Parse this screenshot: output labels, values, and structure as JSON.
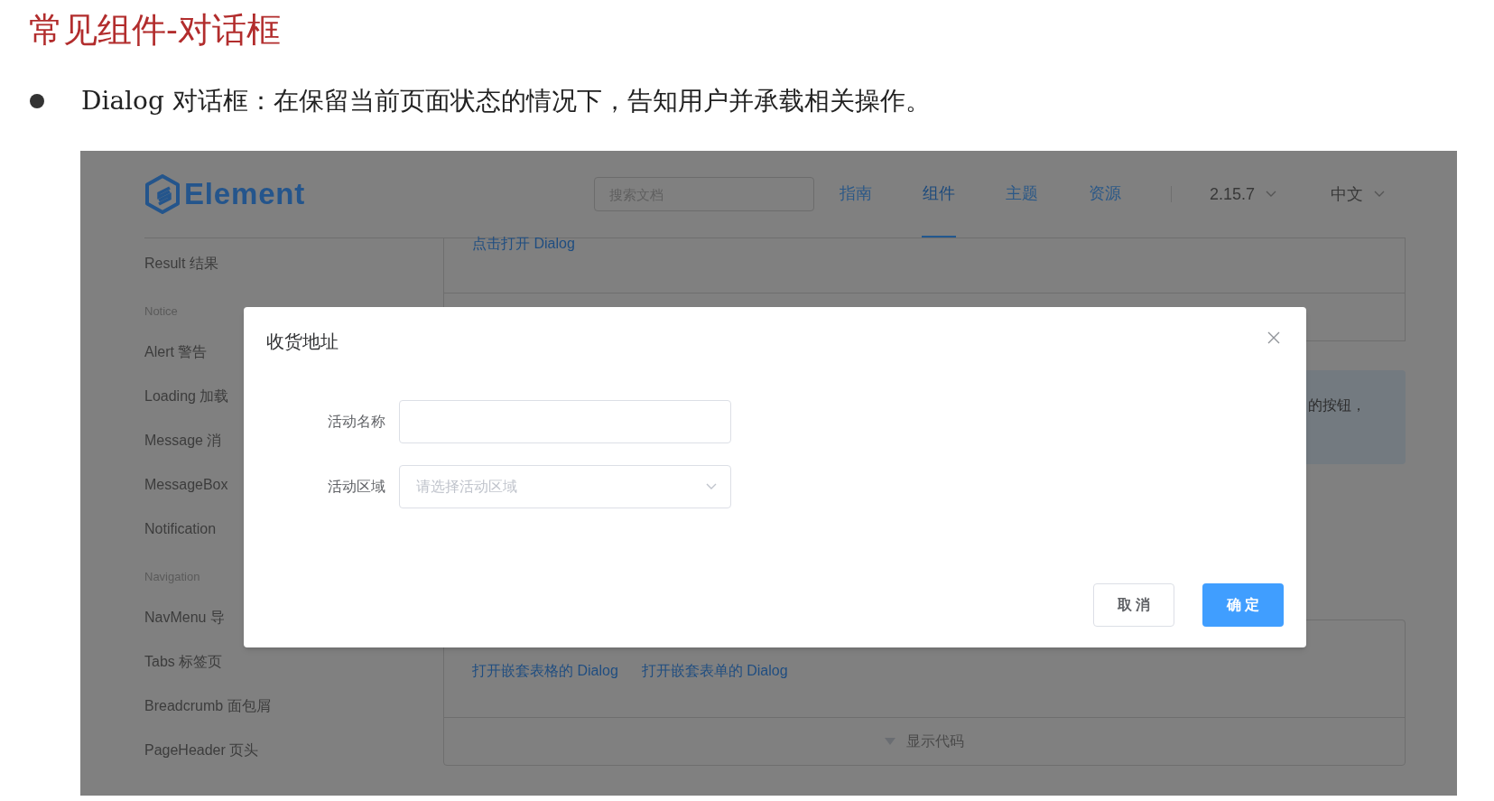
{
  "slide": {
    "title": "常见组件-对话框",
    "bullet": "Dialog 对话框：在保留当前页面状态的情况下，告知用户并承载相关操作。"
  },
  "screenshot": {
    "header": {
      "logo": "Element",
      "search": {
        "placeholder": "搜索文档"
      },
      "nav": [
        {
          "label": "指南",
          "selected": false
        },
        {
          "label": "组件",
          "selected": true
        },
        {
          "label": "主题",
          "selected": false
        },
        {
          "label": "资源",
          "selected": false
        }
      ],
      "version": "2.15.7",
      "language": "中文"
    },
    "sidebar": {
      "items": [
        {
          "kind": "item",
          "label": "Result 结果"
        },
        {
          "kind": "group",
          "label": "Notice"
        },
        {
          "kind": "item",
          "label": "Alert 警告"
        },
        {
          "kind": "item",
          "label": "Loading 加载"
        },
        {
          "kind": "item",
          "label": "Message 消"
        },
        {
          "kind": "item",
          "label": "MessageBox"
        },
        {
          "kind": "item",
          "label": "Notification"
        },
        {
          "kind": "group",
          "label": "Navigation"
        },
        {
          "kind": "item",
          "label": "NavMenu 导"
        },
        {
          "kind": "item",
          "label": "Tabs 标签页"
        },
        {
          "kind": "item",
          "label": "Breadcrumb 面包屑"
        },
        {
          "kind": "item",
          "label": "PageHeader 页头"
        }
      ]
    },
    "content": {
      "top_link": "点击打开 Dialog",
      "alert_text": "的按钮，",
      "links": [
        "打开嵌套表格的 Dialog",
        "打开嵌套表单的 Dialog"
      ],
      "code_toggle": "显示代码"
    },
    "dialog": {
      "title": "收货地址",
      "fields": [
        {
          "kind": "input",
          "label": "活动名称"
        },
        {
          "kind": "select",
          "label": "活动区域",
          "placeholder": "请选择活动区域"
        }
      ],
      "buttons": [
        {
          "label": "取 消",
          "primary": false
        },
        {
          "label": "确 定",
          "primary": true
        }
      ]
    }
  }
}
